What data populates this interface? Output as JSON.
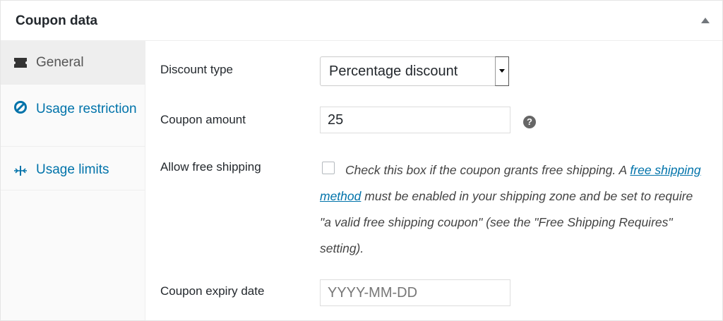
{
  "panel": {
    "title": "Coupon data"
  },
  "sidebar": {
    "tabs": [
      {
        "label": "General",
        "icon": "ticket-icon",
        "active": true
      },
      {
        "label": "Usage restriction",
        "icon": "restriction-icon",
        "active": false
      },
      {
        "label": "Usage limits",
        "icon": "limits-icon",
        "active": false
      }
    ]
  },
  "fields": {
    "discount_type": {
      "label": "Discount type",
      "value": "Percentage discount"
    },
    "coupon_amount": {
      "label": "Coupon amount",
      "value": "25",
      "help": "?"
    },
    "free_shipping": {
      "label": "Allow free shipping",
      "checked": false,
      "desc_before": "Check this box if the coupon grants free shipping. A",
      "link_text": "free shipping method",
      "desc_after": "must be enabled in your shipping zone and be set to require \"a valid free shipping coupon\" (see the \"Free Shipping Requires\" setting)."
    },
    "expiry_date": {
      "label": "Coupon expiry date",
      "placeholder": "YYYY-MM-DD"
    }
  },
  "colors": {
    "link": "#0073aa",
    "text": "#23282d"
  }
}
